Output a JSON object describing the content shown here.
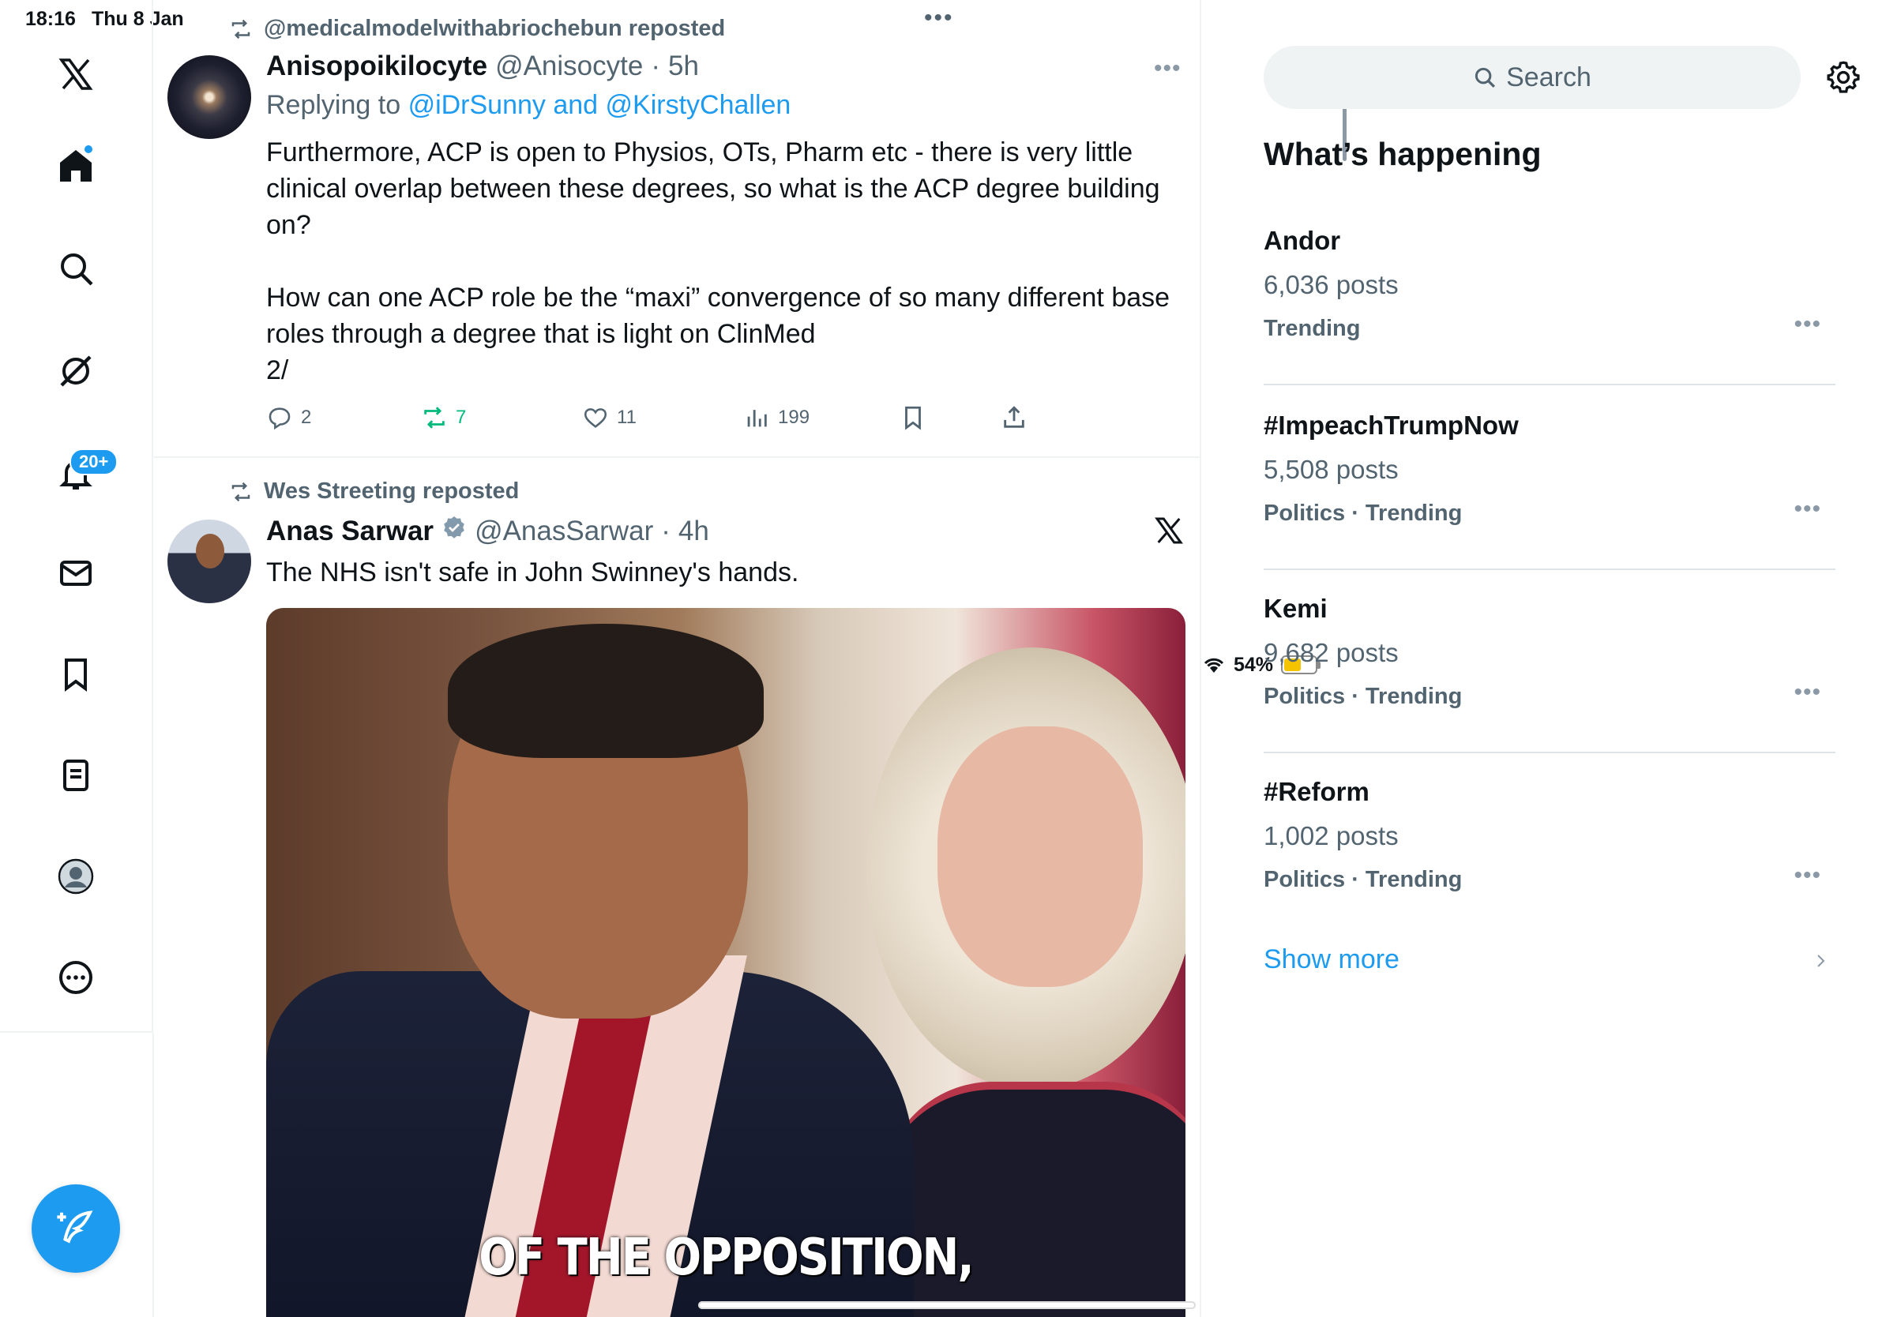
{
  "status_bar": {
    "time": "18:16",
    "date": "Thu 8 Jan",
    "battery": "54%"
  },
  "nav": {
    "items": [
      "x-logo",
      "home",
      "explore",
      "grok",
      "notifications",
      "messages",
      "bookmarks",
      "lists",
      "profile",
      "more"
    ],
    "notifications_badge": "20+"
  },
  "tweets": [
    {
      "repost_by": "@medicalmodelwithabriochebun reposted",
      "name": "Anisopoikilocyte",
      "handle": "@Anisocyte",
      "sep": "·",
      "age": "5h",
      "replying_prefix": "Replying to",
      "replying_to": "@iDrSunny and @KirstyChallen",
      "lines": [
        "Furthermore, ACP is open to Physios, OTs, Pharm etc - there is very little",
        "clinical overlap between these degrees, so what is the ACP degree building",
        "on?",
        "",
        "How can one ACP role be the “maxi” convergence of so many different base",
        "roles through a degree that is light on ClinMed",
        "2/"
      ],
      "replies": "2",
      "reposts": "7",
      "likes": "11",
      "views": "199"
    },
    {
      "repost_by": "Wes Streeting reposted",
      "name": "Anas Sarwar",
      "handle": "@AnasSarwar",
      "sep": "·",
      "age": "4h",
      "text": "The NHS isn't safe in John Swinney's hands.",
      "video_caption": "OF THE OPPOSITION,"
    }
  ],
  "sidebar": {
    "search_placeholder": "Search",
    "section_title": "What’s happening",
    "trends": [
      {
        "name": "Andor",
        "count": "6,036 posts",
        "meta": "Trending"
      },
      {
        "name": "#ImpeachTrumpNow",
        "count": "5,508 posts",
        "meta": "Politics · Trending"
      },
      {
        "name": "Kemi",
        "count": "9,682 posts",
        "meta": "Politics · Trending"
      },
      {
        "name": "#Reform",
        "count": "1,002 posts",
        "meta": "Politics · Trending"
      }
    ],
    "show_more": "Show more"
  },
  "colors": {
    "accent": "#1d9bf0",
    "repost_green": "#00ba7c",
    "text": "#0f1419",
    "muted": "#536471"
  }
}
